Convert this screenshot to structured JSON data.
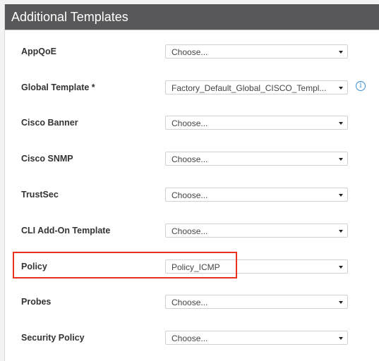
{
  "header": {
    "title": "Additional Templates"
  },
  "rows": [
    {
      "label": "AppQoE",
      "value": "Choose..."
    },
    {
      "label": "Global Template *",
      "value": "Factory_Default_Global_CISCO_Templ...",
      "info_icon": "info-icon"
    },
    {
      "label": "Cisco Banner",
      "value": "Choose..."
    },
    {
      "label": "Cisco SNMP",
      "value": "Choose..."
    },
    {
      "label": "TrustSec",
      "value": "Choose..."
    },
    {
      "label": "CLI Add-On Template",
      "value": "Choose..."
    },
    {
      "label": "Policy",
      "value": "Policy_ICMP",
      "highlighted": true
    },
    {
      "label": "Probes",
      "value": "Choose..."
    },
    {
      "label": "Security Policy",
      "value": "Choose..."
    }
  ],
  "colors": {
    "header_bg": "#58585a",
    "highlight": "#e8321e",
    "info": "#3b8fd6"
  }
}
